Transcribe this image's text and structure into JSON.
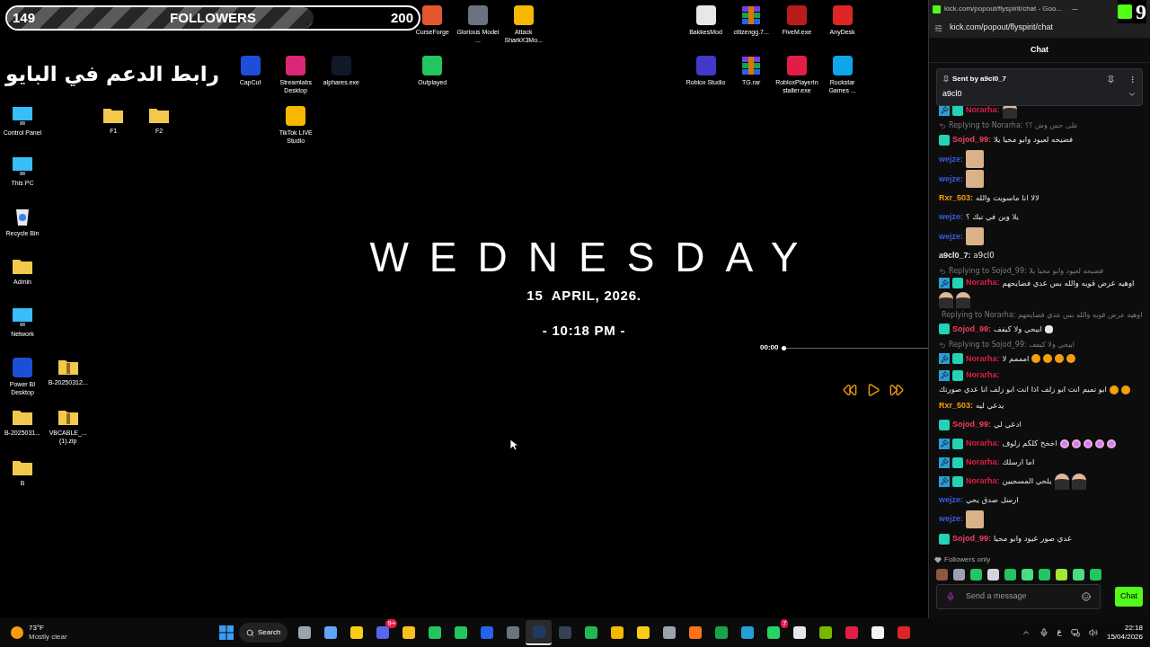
{
  "followers_bar": {
    "current": "149",
    "label": "FOLLOWERS",
    "goal": "200",
    "level": 0.745
  },
  "overlay_text": "رابط الدعم في البايو",
  "corner_number": "9",
  "desktop_icons": [
    {
      "kind": "app",
      "label": "CurseForge"
    },
    {
      "kind": "app",
      "label": "Glorious Model ..."
    },
    {
      "kind": "app",
      "label": "Attack SharkX3Mo..."
    },
    {
      "kind": "app",
      "label": "BakkesMod"
    },
    {
      "kind": "archive",
      "label": "citizengg.7..."
    },
    {
      "kind": "app",
      "label": "FiveM.exe"
    },
    {
      "kind": "app",
      "label": "AnyDesk"
    },
    {
      "kind": "app",
      "label": "CapCut"
    },
    {
      "kind": "app",
      "label": "Streamlabs Desktop"
    },
    {
      "kind": "app",
      "label": "alphares.exe"
    },
    {
      "kind": "app",
      "label": "Outplayed"
    },
    {
      "kind": "app",
      "label": "Roblox Studio"
    },
    {
      "kind": "archive",
      "label": "TG.rar"
    },
    {
      "kind": "app",
      "label": "RobloxPlayerInstaller.exe"
    },
    {
      "kind": "app",
      "label": "Rockstar Games ..."
    },
    {
      "kind": "monitor",
      "label": "Control Panel"
    },
    {
      "kind": "folder",
      "label": "F1"
    },
    {
      "kind": "folder",
      "label": "F2"
    },
    {
      "kind": "app",
      "label": "TikTok LIVE Studio"
    },
    {
      "kind": "monitor",
      "label": "This PC"
    },
    {
      "kind": "bin",
      "label": "Recycle Bin"
    },
    {
      "kind": "folder",
      "label": "Admin"
    },
    {
      "kind": "monitor",
      "label": "Network"
    },
    {
      "kind": "app",
      "label": "Power BI Desktop"
    },
    {
      "kind": "zip",
      "label": "B-20250312..."
    },
    {
      "kind": "folder",
      "label": "B-2025031..."
    },
    {
      "kind": "zip",
      "label": "VBCABLE_... (1).zip"
    },
    {
      "kind": "folder",
      "label": "B"
    }
  ],
  "clock_widget": {
    "day": "WEDNESDAY",
    "date": "15  APRIL, 2026.",
    "time": "- 10:18 PM -"
  },
  "player": {
    "elapsed": "00:00",
    "level": 0
  },
  "chat_window": {
    "title": "kick.com/popout/flyspirit/chat - Goo...",
    "address": "kick.com/popout/flyspirit/chat",
    "header": "Chat",
    "pinned": {
      "sender": "Sent by a9cl0_7",
      "text": "a9cl0"
    },
    "messages": [
      {
        "badges": [
          {
            "kind": "moderator"
          },
          {
            "kind": "og"
          }
        ],
        "user": "Norarha:",
        "color": "#e11d48",
        "emotes": [
          {
            "kind": "person"
          }
        ]
      },
      {
        "reply": "Replying to Norarha: على حس وش ؟؟",
        "badges": [
          {
            "kind": "og"
          }
        ],
        "user": "Sojod_99:",
        "color": "#f43f5e",
        "text": "فضيحه لعيود وابو محيا يلا"
      },
      {
        "user": "wejze:",
        "color": "#3b5bdb",
        "emotes": [
          {
            "kind": "face"
          }
        ]
      },
      {
        "user": "wejze:",
        "color": "#3b5bdb",
        "emotes": [
          {
            "kind": "face"
          }
        ]
      },
      {
        "user": "Rxr_503:",
        "color": "#f59e0b",
        "text": "لالا انا ماسويت والله"
      },
      {
        "user": "wejze:",
        "color": "#3b5bdb",
        "text": "يلا وين في تبك ؟"
      },
      {
        "user": "wejze:",
        "color": "#3b5bdb",
        "emotes": [
          {
            "kind": "face"
          }
        ]
      },
      {
        "user": "a9cl0_7:",
        "color": "#e5e7eb",
        "text": "a9cl0"
      },
      {
        "reply": "Replying to Sojod_99: فضيحه لعيود وابو محيا يلا",
        "badges": [
          {
            "kind": "moderator"
          },
          {
            "kind": "og"
          }
        ],
        "user": "Norarha:",
        "color": "#e11d48",
        "text": "اوهيه عرض قويه والله بس عدي فضايحهم",
        "emotes": [
          {
            "kind": "person"
          },
          {
            "kind": "person"
          }
        ]
      },
      {
        "reply": "Replying to Norarha: اوهيه عرض قويه والله بس عدي فضايحهم",
        "badges": [
          {
            "kind": "og"
          }
        ],
        "user": "Sojod_99:",
        "color": "#f43f5e",
        "text": "ابيحي ولا كيفف",
        "emotes": [
          {
            "kind": "skull"
          }
        ]
      },
      {
        "reply": "Replying to Sojod_99: ابيحي ولا كيفف",
        "badges": [
          {
            "kind": "moderator"
          },
          {
            "kind": "og"
          }
        ],
        "user": "Norarha:",
        "color": "#e11d48",
        "text": "امممم لا",
        "emotes": [
          {
            "kind": "orange"
          },
          {
            "kind": "orange"
          },
          {
            "kind": "orange"
          },
          {
            "kind": "orange"
          }
        ]
      },
      {
        "badges": [
          {
            "kind": "moderator"
          },
          {
            "kind": "og"
          }
        ],
        "user": "Norarha:",
        "color": "#e11d48",
        "text": "ابو تميم انت ابو زلف اذا انت ابو زلف انا عدي صورتك",
        "emotes": [
          {
            "kind": "orange"
          },
          {
            "kind": "orange"
          }
        ]
      },
      {
        "user": "Rxr_503:",
        "color": "#f59e0b",
        "text": "يدعي ليه"
      },
      {
        "badges": [
          {
            "kind": "og"
          }
        ],
        "user": "Sojod_99:",
        "color": "#f43f5e",
        "text": "ادعي لي"
      },
      {
        "badges": [
          {
            "kind": "moderator"
          },
          {
            "kind": "og"
          }
        ],
        "user": "Norarha:",
        "color": "#e11d48",
        "text": "اخخخ كلكم زلوف",
        "emotes": [
          {
            "kind": "purple"
          },
          {
            "kind": "purple"
          },
          {
            "kind": "purple"
          },
          {
            "kind": "purple"
          },
          {
            "kind": "purple"
          }
        ]
      },
      {
        "badges": [
          {
            "kind": "moderator"
          },
          {
            "kind": "og"
          }
        ],
        "user": "Norarha:",
        "color": "#e11d48",
        "text": "اما ارسلك"
      },
      {
        "badges": [
          {
            "kind": "moderator"
          },
          {
            "kind": "og"
          }
        ],
        "user": "Norarha:",
        "color": "#e11d48",
        "text": "يلحي المسجيين",
        "emotes": [
          {
            "kind": "person"
          },
          {
            "kind": "person"
          }
        ]
      },
      {
        "user": "wejze:",
        "color": "#3b5bdb",
        "text": "ارسل صدق يحي"
      },
      {
        "user": "wejze:",
        "color": "#3b5bdb",
        "emotes": [
          {
            "kind": "face"
          }
        ]
      },
      {
        "badges": [
          {
            "kind": "og"
          }
        ],
        "user": "Sojod_99:",
        "color": "#f43f5e",
        "text": "عدي صور عيود وابو محيا"
      }
    ],
    "mode": "Followers only",
    "input_placeholder": "Send a message",
    "send_label": "Chat"
  },
  "taskbar": {
    "temperature": "73°F",
    "weather": "Mostly clear",
    "search": "Search",
    "apps": [
      {
        "kind": "taskview",
        "selected": false
      },
      {
        "kind": "copilot",
        "selected": false
      },
      {
        "kind": "explorer",
        "selected": false
      },
      {
        "kind": "discord",
        "selected": false,
        "badge": "9+"
      },
      {
        "kind": "yellow",
        "selected": false
      },
      {
        "kind": "chrome",
        "selected": false
      },
      {
        "kind": "chrome",
        "selected": false
      },
      {
        "kind": "mail",
        "selected": false
      },
      {
        "kind": "hex",
        "selected": false
      },
      {
        "kind": "steam",
        "selected": true
      },
      {
        "kind": "epic",
        "selected": false
      },
      {
        "kind": "spotify",
        "selected": false
      },
      {
        "kind": "rockstar",
        "selected": false
      },
      {
        "kind": "arc",
        "selected": false
      },
      {
        "kind": "record",
        "selected": false
      },
      {
        "kind": "ea",
        "selected": false
      },
      {
        "kind": "xbox",
        "selected": false
      },
      {
        "kind": "telegram",
        "selected": false
      },
      {
        "kind": "whatsapp",
        "selected": false,
        "badge": "7"
      },
      {
        "kind": "ring",
        "selected": false
      },
      {
        "kind": "nvidia",
        "selected": false
      },
      {
        "kind": "redcircle",
        "selected": false
      },
      {
        "kind": "gear",
        "selected": false
      },
      {
        "kind": "redbox",
        "selected": false
      }
    ],
    "language": "ع",
    "time": "22:18",
    "date": "15/04/2026"
  }
}
